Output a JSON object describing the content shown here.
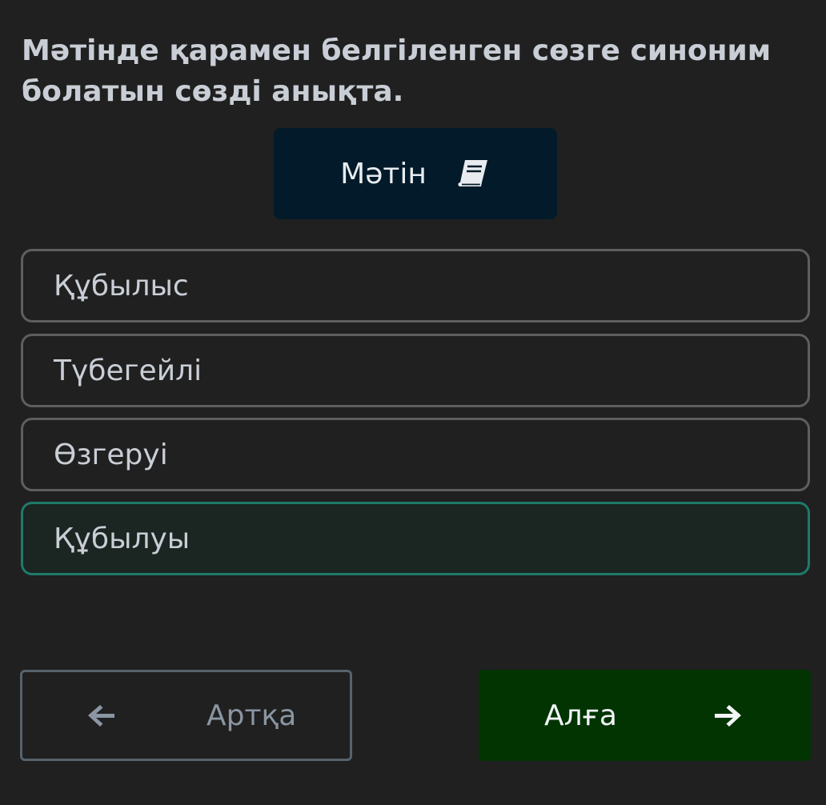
{
  "question": {
    "text": "Мәтінде қарамен белгіленген сөзге синоним болатын сөзді анықта."
  },
  "text_button": {
    "label": "Мәтін",
    "icon": "book-icon"
  },
  "options": [
    {
      "label": "Құбылыс",
      "selected": false
    },
    {
      "label": "Түбегейлі",
      "selected": false
    },
    {
      "label": "Өзгеруі",
      "selected": false
    },
    {
      "label": "Құбылуы",
      "selected": true
    }
  ],
  "navigation": {
    "back": {
      "label": "Артқа",
      "icon": "arrow-left-icon"
    },
    "next": {
      "label": "Алға",
      "icon": "arrow-right-icon"
    }
  },
  "colors": {
    "background": "#202020",
    "text_button_bg": "#021a29",
    "selected_border": "#1f7a6a",
    "next_button_bg": "#013401"
  }
}
